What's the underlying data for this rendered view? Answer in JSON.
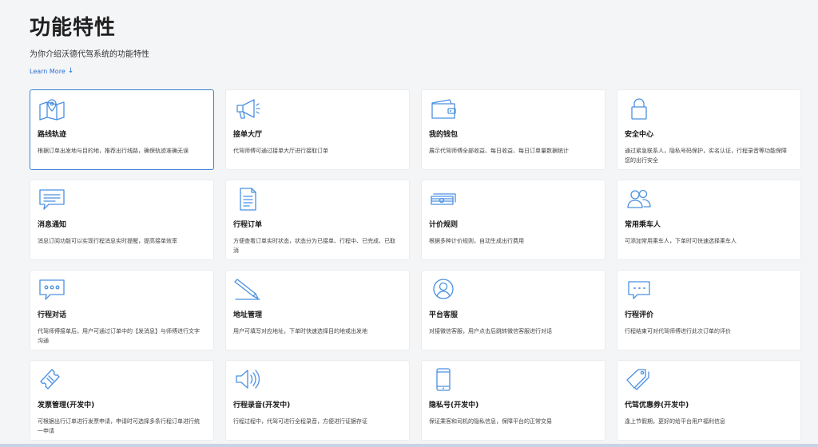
{
  "header": {
    "title": "功能特性",
    "subtitle": "为你介绍沃德代驾系统的功能特性",
    "learn_more": "Learn More"
  },
  "accent_color": "#2a6fd8",
  "icon_color": "#4a90e2",
  "cards": [
    {
      "title": "路线轨迹",
      "desc": "根据订单出发地与目的地，推荐出行线路，确保轨迹准确无误",
      "icon": "map-icon"
    },
    {
      "title": "接单大厅",
      "desc": "代驾师傅可通过接单大厅进行接取订单",
      "icon": "megaphone-icon"
    },
    {
      "title": "我的钱包",
      "desc": "展示代驾师傅全部收益、每日收益、每日订单量数据统计",
      "icon": "wallet-icon"
    },
    {
      "title": "安全中心",
      "desc": "通过紧急联系人，隐私号码保护，实名认证，行程录音等功能保障您的出行安全",
      "icon": "lock-icon"
    },
    {
      "title": "消息通知",
      "desc": "消息订阅功能可以实现行程消息实时提醒，提高接单效率",
      "icon": "message-icon"
    },
    {
      "title": "行程订单",
      "desc": "方便查看订单实时状态，状态分为已接单、行程中、已完成、已取消",
      "icon": "document-icon"
    },
    {
      "title": "计价规则",
      "desc": "根据多种计价规则，自动生成出行费用",
      "icon": "money-icon"
    },
    {
      "title": "常用乘车人",
      "desc": "可添加常用乘车人，下单时可快速选择乘车人",
      "icon": "users-icon"
    },
    {
      "title": "行程对话",
      "desc": "代驾师傅接单后，用户可通过订单中的【发消息】与师傅进行文字沟通",
      "icon": "chat-icon"
    },
    {
      "title": "地址管理",
      "desc": "用户可填写对应地址，下单时快速选择目的地或出发地",
      "icon": "pencil-icon"
    },
    {
      "title": "平台客服",
      "desc": "对接微信客服，用户点击后跳转微信客服进行对话",
      "icon": "support-icon"
    },
    {
      "title": "行程评价",
      "desc": "行程结束可对代驾师傅进行此次订单的评价",
      "icon": "comment-icon"
    },
    {
      "title": "发票管理(开发中)",
      "desc": "可根据出行订单进行发票申请，申请时可选择多条行程订单进行统一申请",
      "icon": "ticket-icon"
    },
    {
      "title": "行程录音(开发中)",
      "desc": "行程过程中，代驾可进行全程录音，方便进行证据存证",
      "icon": "speaker-icon"
    },
    {
      "title": "隐私号(开发中)",
      "desc": "保证乘客和司机的隐私信息，保障平台的正常交易",
      "icon": "phone-icon"
    },
    {
      "title": "代驾优惠券(开发中)",
      "desc": "逢上节假期，更好的给平台用户福利信息",
      "icon": "tag-icon"
    }
  ]
}
